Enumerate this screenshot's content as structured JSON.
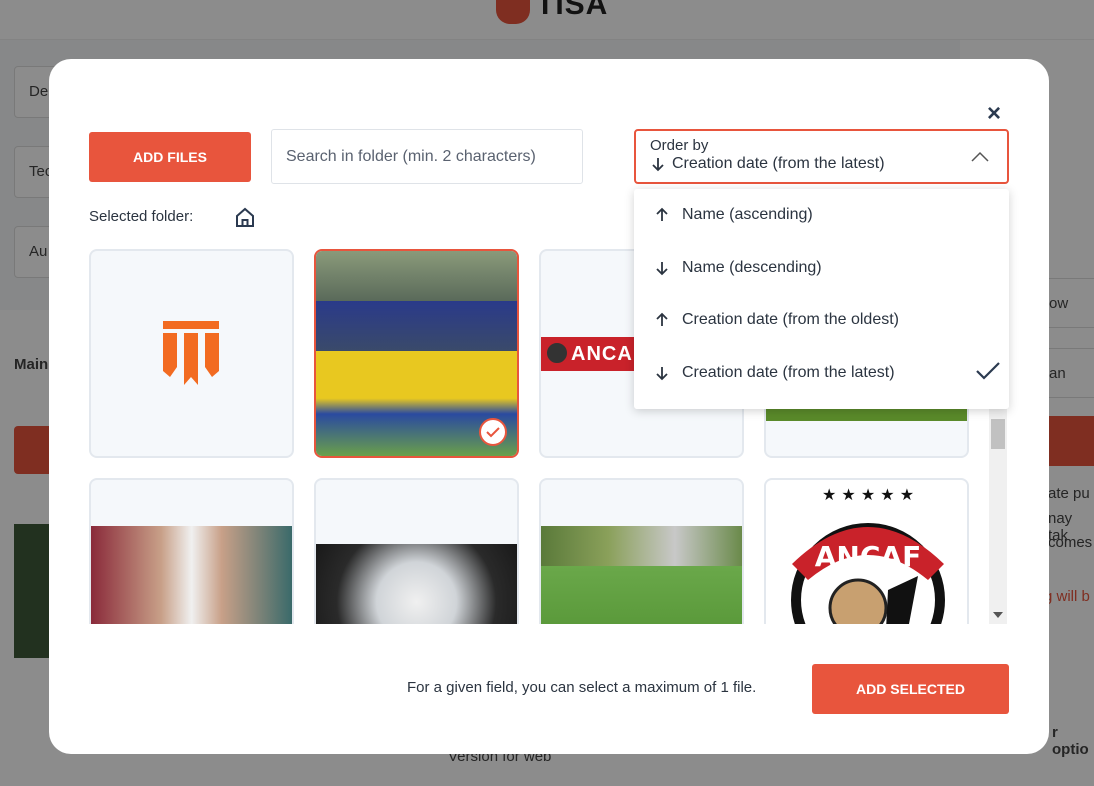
{
  "background": {
    "brand": "TISA",
    "fields": [
      "De",
      "Tec",
      "Au"
    ],
    "main_label": "Main",
    "right_texts": [
      "ow",
      "an",
      "ate pu",
      "nay tak",
      "comes",
      "g will b"
    ],
    "right_bottom": "r optio",
    "footer": "Version for web"
  },
  "modal": {
    "close_label": "×",
    "add_files_label": "ADD FILES",
    "search_placeholder": "Search in folder (min. 2 characters)",
    "order": {
      "label": "Order by",
      "value": "Creation date (from the latest)"
    },
    "dropdown": [
      {
        "label": "Name (ascending)",
        "dir": "up",
        "selected": false
      },
      {
        "label": "Name (descending)",
        "dir": "down",
        "selected": false
      },
      {
        "label": "Creation date (from the oldest)",
        "dir": "up",
        "selected": false
      },
      {
        "label": "Creation date (from the latest)",
        "dir": "down",
        "selected": true
      }
    ],
    "selected_folder_label": "Selected folder:",
    "footer_note": "For a given field, you can select a maximum of 1 file.",
    "add_selected_label": "ADD SELECTED"
  },
  "colors": {
    "accent": "#e8553d",
    "text": "#2b3440",
    "border": "#e3e8ee"
  },
  "tiles": [
    {
      "name": "tisa-logo",
      "text": ""
    },
    {
      "name": "team-photo",
      "text": ""
    },
    {
      "name": "ancaf-banner",
      "text": "ANCAF"
    },
    {
      "name": "football-pitch",
      "text": ""
    },
    {
      "name": "player-photo",
      "text": ""
    },
    {
      "name": "ball-photo",
      "text": ""
    },
    {
      "name": "match-photo",
      "text": ""
    },
    {
      "name": "ancaf-logo",
      "text": "ANCAF"
    }
  ]
}
